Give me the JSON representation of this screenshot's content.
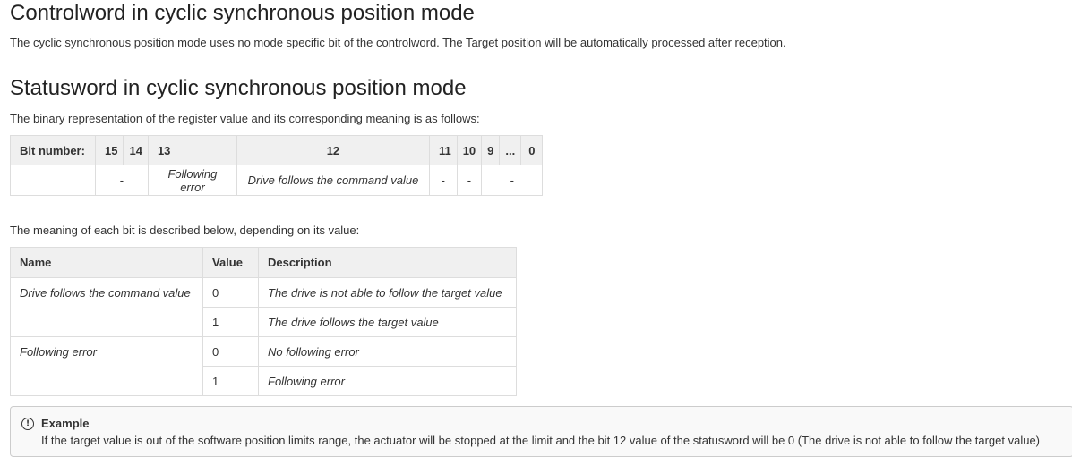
{
  "controlword": {
    "heading": "Controlword in cyclic synchronous position mode",
    "text": "The cyclic synchronous position mode uses no mode specific bit of the controlword. The Target position will be automatically processed after reception."
  },
  "statusword": {
    "heading": "Statusword in cyclic synchronous position mode",
    "intro": "The binary representation of the register value and its corresponding meaning is as follows:",
    "bit_table": {
      "header_label": "Bit number:",
      "bits": [
        "15",
        "14",
        "13",
        "12",
        "11",
        "10",
        "9",
        "...",
        "0"
      ],
      "values": {
        "b15_14": "-",
        "b13": "Following error",
        "b12": "Drive follows the command value",
        "b11": "-",
        "b10": "-",
        "b9_0": "-"
      }
    },
    "meaning_intro": "The meaning of each bit is described below, depending on its value:",
    "meaning_table": {
      "headers": {
        "name": "Name",
        "value": "Value",
        "description": "Description"
      },
      "rows": [
        {
          "name": "Drive follows the command value",
          "values": [
            {
              "value": "0",
              "description": "The drive is not able to follow the target value"
            },
            {
              "value": "1",
              "description": "The drive follows the target value"
            }
          ]
        },
        {
          "name": "Following error",
          "values": [
            {
              "value": "0",
              "description": "No following error"
            },
            {
              "value": "1",
              "description": "Following error"
            }
          ]
        }
      ]
    }
  },
  "example": {
    "icon": "info-icon",
    "title": "Example",
    "text": "If the target value is out of the software position limits range, the actuator will be stopped at the limit and the bit 12 value of the statusword will be 0 (The drive is not able to follow the target value)"
  }
}
